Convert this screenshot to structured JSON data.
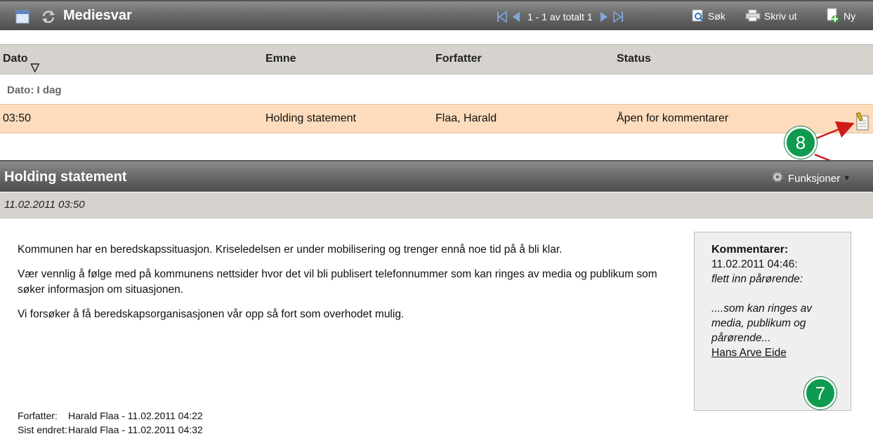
{
  "panel": {
    "title": "Mediesvar",
    "pager_text": "1 - 1 av totalt 1",
    "search_label": "Søk",
    "print_label": "Skriv ut",
    "new_label": "Ny"
  },
  "columns": [
    "Dato",
    "Emne",
    "Forfatter",
    "Status"
  ],
  "group_label": "Dato: I dag",
  "row": {
    "time": "03:50",
    "subject": "Holding statement",
    "author": "Flaa, Harald",
    "status": "Åpen for kommentarer"
  },
  "annotations": {
    "a8": "8",
    "a7": "7"
  },
  "detail": {
    "title": "Holding statement",
    "functions_label": "Funksjoner",
    "date": "11.02.2011 03:50",
    "paragraphs": [
      "Kommunen har en beredskapssituasjon. Kriseledelsen er under mobilisering og trenger ennå noe tid på å bli klar.",
      "Vær vennlig å følge med på kommunens nettsider hvor det vil bli publisert telefonnummer som kan ringes av media og publikum som søker informasjon om situasjonen.",
      "Vi forsøker å få beredskapsorganisasjonen vår opp så fort som overhodet mulig."
    ],
    "author_label": "Forfatter:",
    "author_value": "Harald Flaa - 11.02.2011 04:22",
    "changed_label": "Sist endret:",
    "changed_value": "Harald Flaa - 11.02.2011 04:32"
  },
  "comments": {
    "heading": "Kommentarer:",
    "timestamp": "11.02.2011 04:46:",
    "line1": "flett inn pårørende:",
    "line2": "....som kan ringes av media, publikum og pårørende...",
    "author": "Hans Arve Eide"
  },
  "colors": {
    "header_gradient_top": "#8c8c8c",
    "header_gradient_bottom": "#4d4d4d",
    "column_header_bg": "#d6d3ce",
    "selected_row_bg": "#fcdcbc",
    "annotation_green": "#0e9b4f",
    "arrow_red": "#d11a1a"
  }
}
